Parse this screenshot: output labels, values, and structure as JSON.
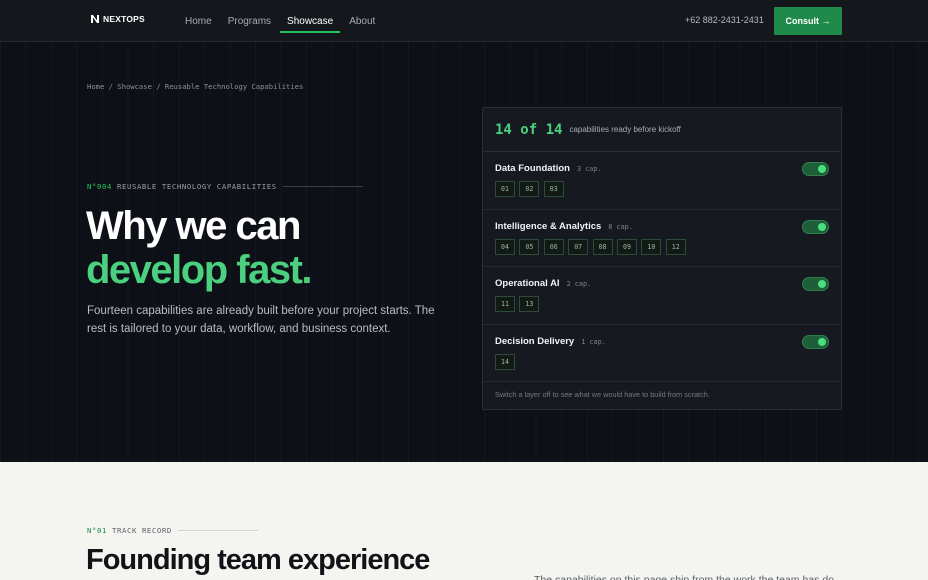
{
  "nav": {
    "brand": "NEXTOPS",
    "links": [
      {
        "label": "Home",
        "active": false
      },
      {
        "label": "Programs",
        "active": false
      },
      {
        "label": "Showcase",
        "active": true
      },
      {
        "label": "About",
        "active": false
      }
    ],
    "phone": "+62 882-2431-2431",
    "cta": "Consult →"
  },
  "breadcrumb": "Home / Showcase / Reusable Technology Capabilities",
  "hero": {
    "eyebrow_num": "N°004",
    "eyebrow_label": "REUSABLE TECHNOLOGY CAPABILITIES",
    "headline_line1": "Why we can",
    "headline_line2": "develop fast.",
    "subcopy": "Fourteen capabilities are already built before your project starts. The rest is tailored to your data, workflow, and business context."
  },
  "panel": {
    "count": "14 of 14",
    "count_label": "capabilities ready before kickoff",
    "layers": [
      {
        "name": "Data Foundation",
        "cap": "3 cap.",
        "enabled": true,
        "chips": [
          "01",
          "02",
          "03"
        ]
      },
      {
        "name": "Intelligence & Analytics",
        "cap": "8 cap.",
        "enabled": true,
        "chips": [
          "04",
          "05",
          "06",
          "07",
          "08",
          "09",
          "10",
          "12"
        ]
      },
      {
        "name": "Operational AI",
        "cap": "2 cap.",
        "enabled": true,
        "chips": [
          "11",
          "13"
        ]
      },
      {
        "name": "Decision Delivery",
        "cap": "1 cap.",
        "enabled": true,
        "chips": [
          "14"
        ]
      }
    ],
    "footer": "Switch a layer off to see what we would have to build from scratch."
  },
  "track": {
    "eyebrow_num": "N°01",
    "eyebrow_label": "TRACK RECORD",
    "title": "Founding team experience",
    "peek_text": "The capabilities on this page ship from the work the team has done before."
  },
  "colors": {
    "accent": "#4ad07e",
    "cta_bg": "#1f8a4a",
    "dark_bg": "#0d1016",
    "light_bg": "#f4f4f0"
  }
}
